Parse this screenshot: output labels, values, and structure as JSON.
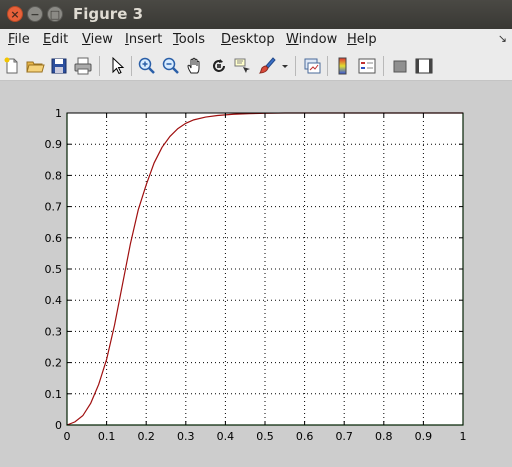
{
  "window": {
    "title": "Figure 3"
  },
  "menu": [
    {
      "label": "File",
      "mnemonic": "F",
      "rest": "ile"
    },
    {
      "label": "Edit",
      "mnemonic": "E",
      "rest": "dit"
    },
    {
      "label": "View",
      "mnemonic": "V",
      "rest": "iew"
    },
    {
      "label": "Insert",
      "mnemonic": "I",
      "rest": "nsert"
    },
    {
      "label": "Tools",
      "mnemonic": "T",
      "rest": "ools"
    },
    {
      "label": "Desktop",
      "mnemonic": "D",
      "rest": "esktop"
    },
    {
      "label": "Window",
      "mnemonic": "W",
      "rest": "indow"
    },
    {
      "label": "Help",
      "mnemonic": "H",
      "rest": "elp"
    }
  ],
  "toolbar": {
    "icons": [
      "new-figure-icon",
      "open-file-icon",
      "save-icon",
      "print-icon",
      "edit-plot-icon",
      "zoom-in-icon",
      "zoom-out-icon",
      "pan-icon",
      "rotate-3d-icon",
      "data-cursor-icon",
      "brush-icon",
      "brush-dropdown-icon",
      "link-plot-icon",
      "colorbar-icon",
      "legend-icon",
      "hide-plot-tools-icon",
      "show-plot-tools-icon"
    ]
  },
  "chart_data": {
    "type": "line",
    "xlim": [
      0,
      1
    ],
    "ylim": [
      0,
      1
    ],
    "grid": true,
    "xticks": [
      0,
      0.1,
      0.2,
      0.3,
      0.4,
      0.5,
      0.6,
      0.7,
      0.8,
      0.9,
      1
    ],
    "yticks": [
      0,
      0.1,
      0.2,
      0.3,
      0.4,
      0.5,
      0.6,
      0.7,
      0.8,
      0.9,
      1
    ],
    "xtick_labels": [
      "0",
      "0.1",
      "0.2",
      "0.3",
      "0.4",
      "0.5",
      "0.6",
      "0.7",
      "0.8",
      "0.9",
      "1"
    ],
    "ytick_labels": [
      "0",
      "0.1",
      "0.2",
      "0.3",
      "0.4",
      "0.5",
      "0.6",
      "0.7",
      "0.8",
      "0.9",
      "1"
    ],
    "series": [
      {
        "color": "#a01010",
        "x": [
          0,
          0.02,
          0.04,
          0.06,
          0.08,
          0.1,
          0.12,
          0.14,
          0.16,
          0.18,
          0.2,
          0.22,
          0.24,
          0.26,
          0.28,
          0.3,
          0.32,
          0.35,
          0.38,
          0.42,
          0.46,
          0.5,
          0.55,
          0.6,
          0.7,
          0.8,
          0.9,
          1
        ],
        "y": [
          0,
          0.01,
          0.03,
          0.07,
          0.13,
          0.21,
          0.32,
          0.45,
          0.58,
          0.69,
          0.77,
          0.84,
          0.89,
          0.925,
          0.95,
          0.967,
          0.978,
          0.987,
          0.992,
          0.996,
          0.998,
          0.999,
          1,
          1,
          1,
          1,
          1,
          1
        ]
      },
      {
        "color": "#20c020",
        "x": [
          0,
          0,
          1,
          1
        ],
        "y": [
          1,
          0,
          0,
          1
        ]
      }
    ]
  }
}
